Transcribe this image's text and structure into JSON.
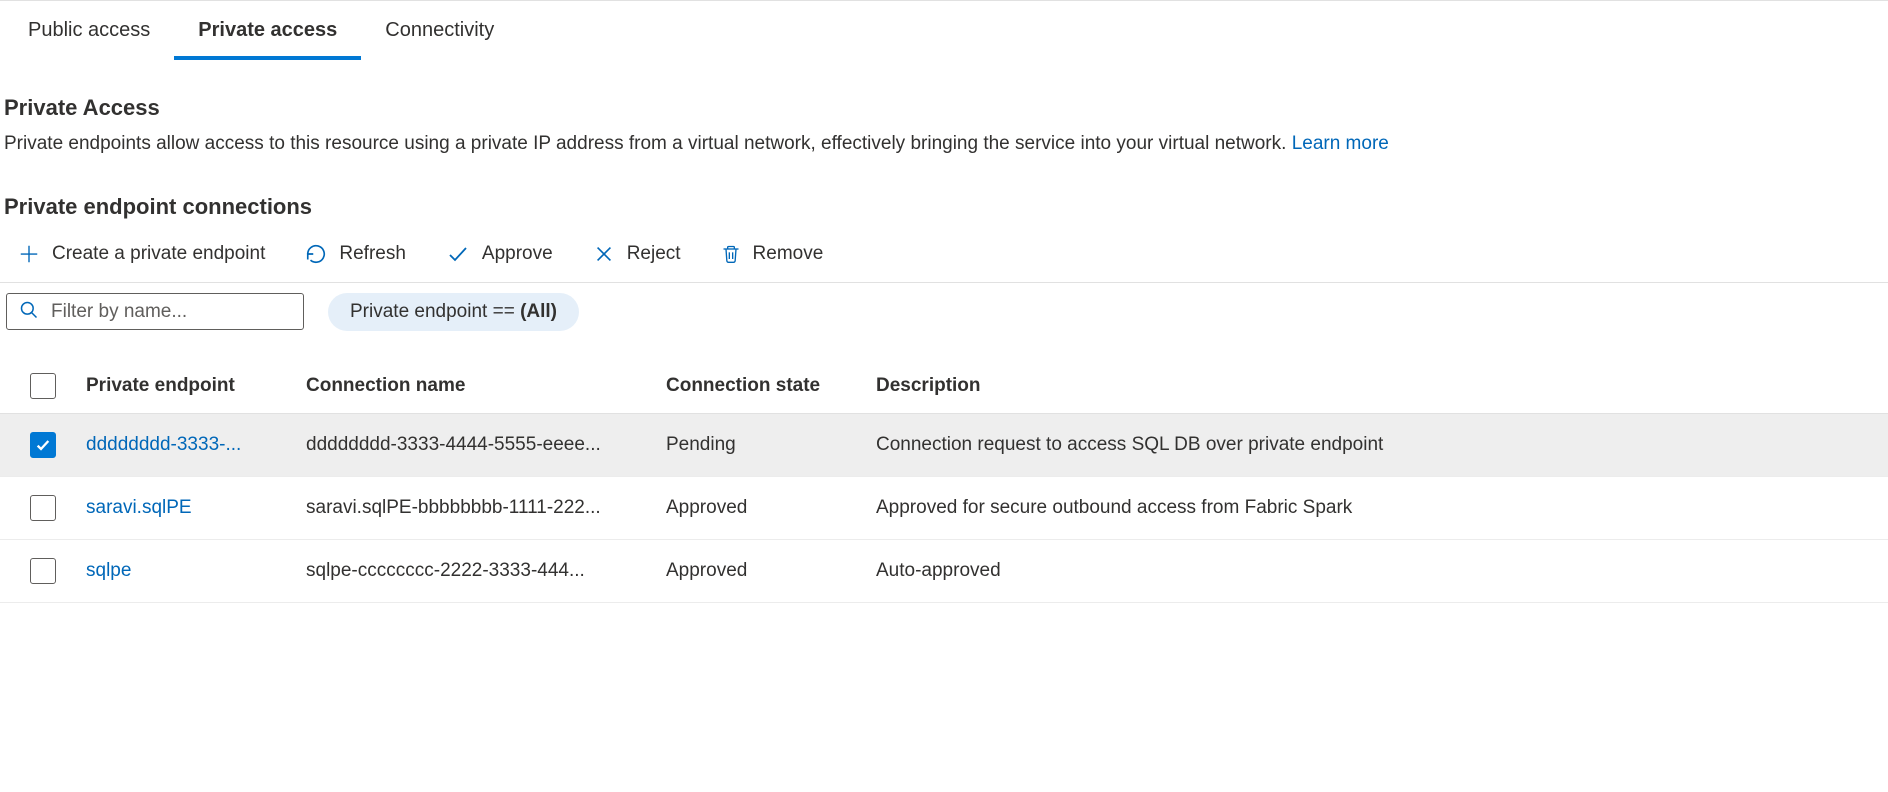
{
  "tabs": [
    {
      "label": "Public access",
      "active": false
    },
    {
      "label": "Private access",
      "active": true
    },
    {
      "label": "Connectivity",
      "active": false
    }
  ],
  "section": {
    "title": "Private Access",
    "description": "Private endpoints allow access to this resource using a private IP address from a virtual network, effectively bringing the service into your virtual network. ",
    "learn_more": "Learn more"
  },
  "subsection_title": "Private endpoint connections",
  "toolbar": {
    "create": "Create a private endpoint",
    "refresh": "Refresh",
    "approve": "Approve",
    "reject": "Reject",
    "remove": "Remove"
  },
  "filter": {
    "placeholder": "Filter by name...",
    "pill_prefix": "Private endpoint == ",
    "pill_value": "(All)"
  },
  "table": {
    "headers": {
      "private_endpoint": "Private endpoint",
      "connection_name": "Connection name",
      "connection_state": "Connection state",
      "description": "Description"
    },
    "rows": [
      {
        "checked": true,
        "private_endpoint": "dddddddd-3333-...",
        "connection_name": "dddddddd-3333-4444-5555-eeee...",
        "connection_state": "Pending",
        "description": "Connection request to access SQL DB over private endpoint"
      },
      {
        "checked": false,
        "private_endpoint": "saravi.sqlPE",
        "connection_name": "saravi.sqlPE-bbbbbbbb-1111-222...",
        "connection_state": "Approved",
        "description": "Approved for secure outbound access from Fabric Spark"
      },
      {
        "checked": false,
        "private_endpoint": "sqlpe",
        "connection_name": "sqlpe-cccccccc-2222-3333-444...",
        "connection_state": "Approved",
        "description": "Auto-approved"
      }
    ]
  }
}
